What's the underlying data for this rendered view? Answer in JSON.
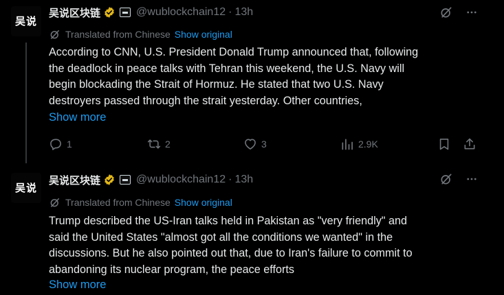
{
  "tweets": [
    {
      "avatar_text": "吴说",
      "display_name": "吴说区块链",
      "handle": "@wublockchain12",
      "separator": "·",
      "time": "13h",
      "translated_label": "Translated from Chinese",
      "show_original": "Show original",
      "body_lines": [
        "According to CNN, U.S. President Donald Trump announced that, following",
        "the deadlock in peace talks with Tehran this weekend, the U.S. Navy will",
        "begin blockading the Strait of Hormuz. He stated that two U.S. Navy",
        "destroyers passed through the strait yesterday. Other countries,"
      ],
      "show_more": "Show more",
      "stats": {
        "replies": "1",
        "reposts": "2",
        "likes": "3",
        "views": "2.9K"
      }
    },
    {
      "avatar_text": "吴说",
      "display_name": "吴说区块链",
      "handle": "@wublockchain12",
      "separator": "·",
      "time": "13h",
      "translated_label": "Translated from Chinese",
      "show_original": "Show original",
      "body_lines": [
        "Trump described the US-Iran talks held in Pakistan as \"very friendly\" and",
        "said the United States \"almost got all the conditions we wanted\" in the",
        "discussions. But he also pointed out that, due to Iran's failure to commit to",
        "abandoning its nuclear program, the peace efforts"
      ],
      "show_more": "Show more"
    }
  ],
  "colors": {
    "background": "#000000",
    "text_primary": "#e7e9ea",
    "text_secondary": "#71767b",
    "link": "#1d9bf0",
    "verified_gold": "#e2b719",
    "thread_line": "#333639"
  },
  "icons": {
    "verified": "verified-gold-badge-icon",
    "affiliate": "affiliate-badge-icon",
    "grok": "grok-icon",
    "more": "more-icon",
    "translate": "translate-icon",
    "reply": "reply-icon",
    "repost": "repost-icon",
    "like": "like-icon",
    "views": "views-icon",
    "bookmark": "bookmark-icon",
    "share": "share-icon"
  }
}
